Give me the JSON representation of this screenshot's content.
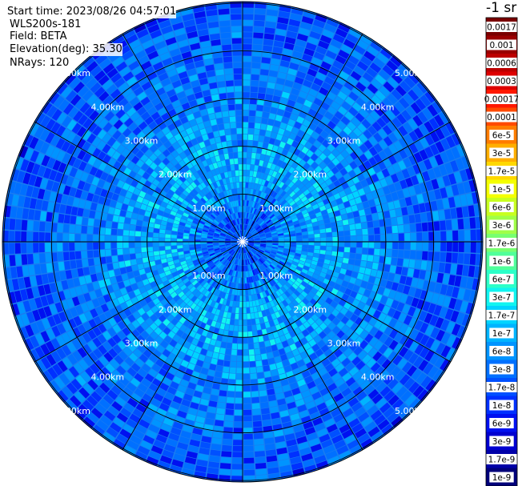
{
  "header": {
    "start_time": "Start time: 2023/08/26 04:57:01",
    "instrument": "WLS200s-181",
    "field": "Field: BETA",
    "elevation": "Elevation(deg): 35.30",
    "nrays": "NRays: 120"
  },
  "colorbar": {
    "unit_label": "-1 sr",
    "entries": [
      {
        "label": "0.0017",
        "color": "#7a0000"
      },
      {
        "label": "0.001",
        "color": "#9a0000"
      },
      {
        "label": "0.0006",
        "color": "#bc0000"
      },
      {
        "label": "0.0003",
        "color": "#de0000"
      },
      {
        "label": "0.00017",
        "color": "#ff1800"
      },
      {
        "label": "0.0001",
        "color": "#ff4a00"
      },
      {
        "label": "6e-5",
        "color": "#ff7c00"
      },
      {
        "label": "3e-5",
        "color": "#ffae00"
      },
      {
        "label": "1.7e-5",
        "color": "#ffd800"
      },
      {
        "label": "1e-5",
        "color": "#f4ff00"
      },
      {
        "label": "6e-6",
        "color": "#c8ff20"
      },
      {
        "label": "3e-6",
        "color": "#a0ff48"
      },
      {
        "label": "1.7e-6",
        "color": "#78ff70"
      },
      {
        "label": "1e-6",
        "color": "#50ff9a"
      },
      {
        "label": "6e-7",
        "color": "#2cffc8"
      },
      {
        "label": "3e-7",
        "color": "#10f4f0"
      },
      {
        "label": "1.7e-7",
        "color": "#00d4ff"
      },
      {
        "label": "1e-7",
        "color": "#00b4ff"
      },
      {
        "label": "6e-8",
        "color": "#0094ff"
      },
      {
        "label": "3e-8",
        "color": "#0070ff"
      },
      {
        "label": "1.7e-8",
        "color": "#0050ff"
      },
      {
        "label": "1e-8",
        "color": "#0030ff"
      },
      {
        "label": "6e-9",
        "color": "#0010f0"
      },
      {
        "label": "3e-9",
        "color": "#0000d0"
      },
      {
        "label": "1.7e-9",
        "color": "#0000a8"
      },
      {
        "label": "1e-9",
        "color": "#00007a"
      }
    ]
  },
  "chart_data": {
    "type": "heatmap",
    "projection": "polar (PPI)",
    "field": "BETA",
    "elevation_deg": 35.3,
    "n_rays": 120,
    "range_rings_km": [
      1,
      2,
      3,
      4,
      5
    ],
    "range_ring_labels": [
      "1.00km",
      "2.00km",
      "3.00km",
      "4.00km",
      "5.00km"
    ],
    "max_range_km": 5.03,
    "azimuth_spokes_deg": [
      0,
      30,
      60,
      90,
      120,
      150,
      180,
      210,
      240,
      270,
      300,
      330
    ],
    "value_scale": "log",
    "value_range": [
      1e-09,
      0.0017
    ],
    "typical_value_by_range_km": [
      {
        "range_km": 0.5,
        "value": 2e-08
      },
      {
        "range_km": 1.5,
        "value": 1e-07
      },
      {
        "range_km": 2.5,
        "value": 6e-08
      },
      {
        "range_km": 3.5,
        "value": 3e-08
      },
      {
        "range_km": 4.5,
        "value": 2e-08
      },
      {
        "range_km": 5.0,
        "value": 1.5e-08
      }
    ],
    "grid": true
  },
  "icons": {
    "center_marker": "center-burst-icon"
  }
}
